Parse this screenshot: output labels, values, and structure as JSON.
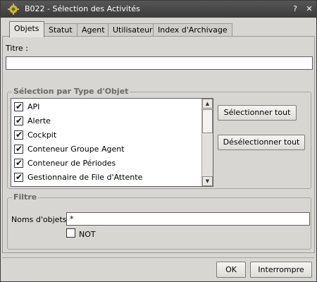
{
  "window": {
    "title": "B022 - Sélection des Activités",
    "icon": "gear-wheel-icon",
    "help_glyph": "?",
    "close_glyph": "✕"
  },
  "tabs": [
    {
      "label": "Objets",
      "active": true
    },
    {
      "label": "Statut",
      "active": false
    },
    {
      "label": "Agent",
      "active": false
    },
    {
      "label": "Utilisateur",
      "active": false
    },
    {
      "label": "Index d'Archivage",
      "active": false
    }
  ],
  "title_field": {
    "label": "Titre :",
    "value": ""
  },
  "type_group": {
    "legend": "Sélection par Type d'Objet",
    "items": [
      {
        "label": "API",
        "checked": true
      },
      {
        "label": "Alerte",
        "checked": true
      },
      {
        "label": "Cockpit",
        "checked": true
      },
      {
        "label": "Conteneur Groupe Agent",
        "checked": true
      },
      {
        "label": "Conteneur de Périodes",
        "checked": true
      },
      {
        "label": "Gestionnaire de File d'Attente",
        "checked": true
      }
    ],
    "select_all_label": "Sélectionner tout",
    "deselect_all_label": "Désélectionner tout"
  },
  "filter_group": {
    "legend": "Filtre",
    "names_label": "Noms d'objets:",
    "names_value": "*",
    "not_label": "NOT",
    "not_checked": false
  },
  "footer": {
    "ok_label": "OK",
    "cancel_label": "Interrompre"
  },
  "colors": {
    "titlebar": "#3b3b3b",
    "panel": "#d8d6d2",
    "legend_text": "#6a6a6a"
  }
}
